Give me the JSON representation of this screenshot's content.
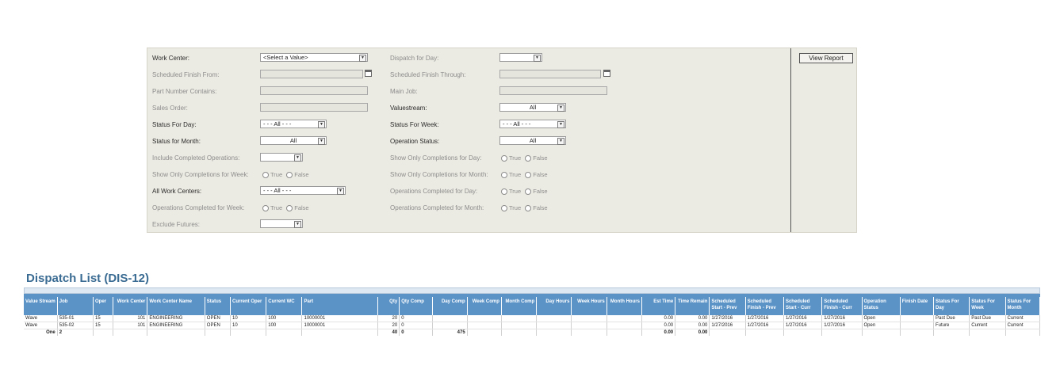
{
  "params": {
    "work_center": {
      "label": "Work Center:",
      "value": "<Select a Value>"
    },
    "dispatch_for_day": {
      "label": "Dispatch for Day:",
      "value": ""
    },
    "scheduled_finish_from": {
      "label": "Scheduled Finish From:",
      "value": ""
    },
    "scheduled_finish_through": {
      "label": "Scheduled Finish Through:",
      "value": ""
    },
    "part_number_contains": {
      "label": "Part Number Contains:",
      "value": ""
    },
    "main_job": {
      "label": "Main Job:",
      "value": ""
    },
    "sales_order": {
      "label": "Sales Order:",
      "value": ""
    },
    "valuestream": {
      "label": "Valuestream:",
      "value": "All"
    },
    "status_for_day": {
      "label": "Status For Day:",
      "value": "- - - All - - -"
    },
    "status_for_week": {
      "label": "Status For Week:",
      "value": "- - - All - - -"
    },
    "status_for_month": {
      "label": "Status for Month:",
      "value": "All"
    },
    "operation_status": {
      "label": "Operation Status:",
      "value": "All"
    },
    "include_completed_operations": {
      "label": "Include Completed Operations:",
      "value": ""
    },
    "show_only_completions_for_day": {
      "label": "Show Only Completions for Day:"
    },
    "show_only_completions_for_week": {
      "label": "Show Only Completions for Week:"
    },
    "show_only_completions_for_month": {
      "label": "Show Only Completions for Month:"
    },
    "all_work_centers": {
      "label": "All Work Centers:",
      "value": "- - - All - - -"
    },
    "operations_completed_for_day": {
      "label": "Operations Completed for Day:"
    },
    "operations_completed_for_week": {
      "label": "Operations Completed for Week:"
    },
    "operations_completed_for_month": {
      "label": "Operations Completed for Month:"
    },
    "exclude_futures": {
      "label": "Exclude Futures:",
      "value": ""
    },
    "radio_true": "True",
    "radio_false": "False",
    "view_report_label": "View Report"
  },
  "report": {
    "title": "Dispatch List (DIS-12)",
    "columns": [
      "Value Stream",
      "Job",
      "Oper",
      "Work Center",
      "Work Center Name",
      "Status",
      "Current Oper",
      "Current WC",
      "Part",
      "Qty",
      "Qty Comp",
      "Day Comp",
      "Week Comp",
      "Month Comp",
      "Day Hours",
      "Week Hours",
      "Month Hours",
      "Est Time",
      "Time Remain",
      "Scheduled Start - Prev",
      "Scheduled Finish - Prev",
      "Scheduled Start - Curr",
      "Scheduled Finish - Curr",
      "Operation Status",
      "Finish Date",
      "Status For Day",
      "Status For Week",
      "Status For Month"
    ],
    "rows": [
      [
        "Wave",
        "535-01",
        "15",
        "101",
        "ENGINEERING",
        "OPEN",
        "10",
        "100",
        "10000001",
        "20",
        "0",
        "",
        "",
        "",
        "",
        "",
        "",
        "0.00",
        "0.00",
        "1/27/2016",
        "1/27/2016",
        "1/27/2016",
        "1/27/2016",
        "Open",
        "",
        "Past Due",
        "Past Due",
        "Current"
      ],
      [
        "Wave",
        "535-02",
        "15",
        "101",
        "ENGINEERING",
        "OPEN",
        "10",
        "100",
        "10000001",
        "20",
        "0",
        "",
        "",
        "",
        "",
        "",
        "",
        "0.00",
        "0.00",
        "1/27/2016",
        "1/27/2016",
        "1/27/2016",
        "1/27/2016",
        "Open",
        "",
        "Future",
        "Current",
        "Current"
      ]
    ],
    "totals": [
      "One",
      "2",
      "",
      "",
      "",
      "",
      "",
      "",
      "",
      "40",
      "0",
      "475",
      "",
      "",
      "",
      "",
      "",
      "0.00",
      "0.00",
      "",
      "",
      "",
      "",
      "",
      "",
      "",
      "",
      ""
    ]
  }
}
